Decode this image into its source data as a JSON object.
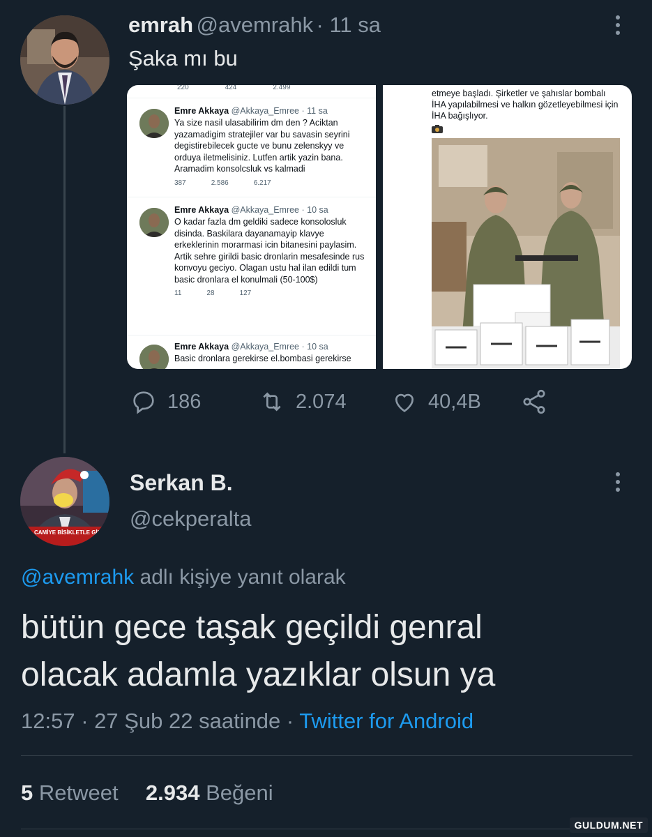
{
  "tweet1": {
    "name": "emrah",
    "handle": "@avemrahk",
    "time": "· 11 sa",
    "text": "Şaka mı bu",
    "stats": {
      "replies": "186",
      "retweets": "2.074",
      "likes": "40,4B"
    }
  },
  "media_left": {
    "top_stats": [
      "220",
      "424",
      "2.499"
    ],
    "tweets": [
      {
        "name": "Emre Akkaya",
        "meta": "@Akkaya_Emree · 11 sa",
        "body": "Ya size nasil ulasabilirim dm den ? Aciktan yazamadigim stratejiler var bu savasin seyrini degistirebilecek gucte ve bunu zelenskyy ve orduya iletmelisiniz. Lutfen artik yazin bana. Aramadim konsolcsluk vs kalmadi",
        "stats": [
          "387",
          "2.586",
          "6.217"
        ]
      },
      {
        "name": "Emre Akkaya",
        "meta": "@Akkaya_Emree · 10 sa",
        "body": "O kadar fazla dm geldiki sadece konsolosluk disinda. Baskilara dayanamayip klavye erkeklerinin morarmasi icin bitanesini paylasim. Artik sehre girildi basic dronlarin mesafesinde rus konvoyu geciyo. Olagan ustu hal ilan edildi tum basic dronlara el konulmali (50-100$)",
        "stats": [
          "11",
          "28",
          "127"
        ]
      },
      {
        "name": "Emre Akkaya",
        "meta": "@Akkaya_Emree · 10 sa",
        "body": "Basic dronlara gerekirse el.bombasi gerekirse",
        "stats": []
      }
    ]
  },
  "media_right": {
    "caption": "etmeye başladı. Şirketler ve şahıslar bombalı İHA yapılabilmesi ve halkın gözetleyebilmesi için İHA bağışlıyor.",
    "camera_icon": "camera-icon"
  },
  "tweet2": {
    "name": "Serkan B.",
    "handle": "@cekperalta",
    "avatar_banner": "CAMİYE BİSİKLETLE GİR",
    "reply_handle": "@avemrahk",
    "reply_suffix": " adlı kişiye yanıt olarak",
    "text": "bütün gece taşak geçildi genral olacak adamla yazıklar olsun ya",
    "meta_time": "12:57 · 27 Şub 22 saatinde · ",
    "meta_source": "Twitter for Android",
    "retweet_count": "5",
    "retweet_label": "Retweet",
    "like_count": "2.934",
    "like_label": "Beğeni"
  },
  "watermark": "GULDUM.NET",
  "colors": {
    "background": "#15202b",
    "accent": "#1d9bf0",
    "muted": "#8b98a5",
    "text": "#e7e9ea",
    "divider": "#38444d"
  }
}
